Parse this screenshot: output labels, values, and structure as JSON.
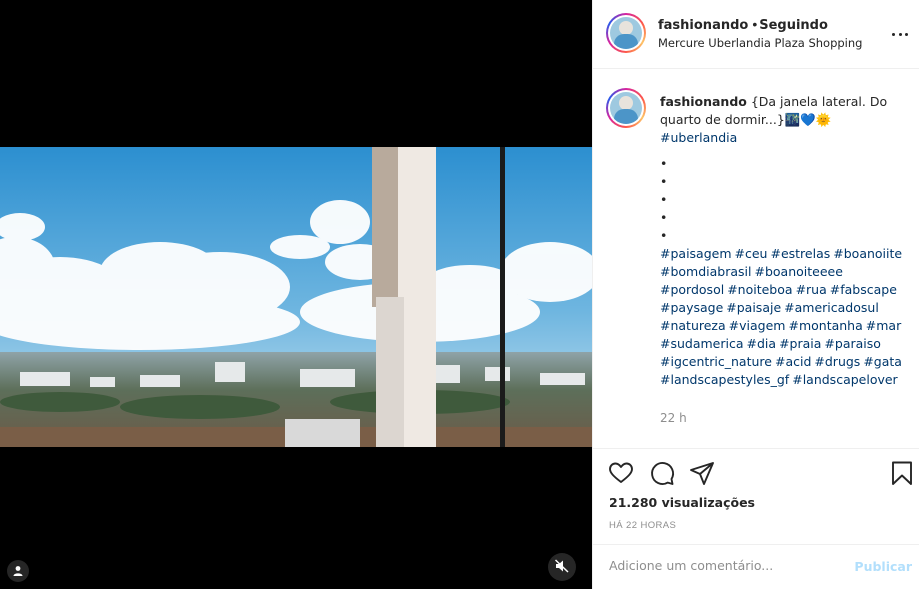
{
  "post": {
    "username": "fashionando",
    "separator": "•",
    "follow_status": "Seguindo",
    "location": "Mercure Uberlandia Plaza Shopping",
    "more_icon": "more-options-icon"
  },
  "caption": {
    "username": "fashionando",
    "text": "{Da janela lateral. Do quarto de dormir...}🌃💙🌞",
    "first_hashtag": "#uberlandia",
    "dots": [
      "•",
      "•",
      "•",
      "•",
      "•"
    ],
    "hashtags": [
      "#paisagem",
      "#ceu",
      "#estrelas",
      "#boanoiite",
      "#bomdiabrasil",
      "#boanoiteeee",
      "#pordosol",
      "#noiteboa",
      "#rua",
      "#fabscape",
      "#paysage",
      "#paisaje",
      "#americadosul",
      "#natureza",
      "#viagem",
      "#montanha",
      "#mar",
      "#sudamerica",
      "#dia",
      "#praia",
      "#paraiso",
      "#igcentric_nature",
      "#acid",
      "#drugs",
      "#gata",
      "#landscapestyles_gf",
      "#landscapelover"
    ],
    "time": "22 h"
  },
  "actions": {
    "like_icon": "heart-icon",
    "comment_icon": "comment-icon",
    "share_icon": "share-icon",
    "save_icon": "bookmark-icon",
    "views": "21.280 visualizações",
    "posted": "HÁ 22 HORAS"
  },
  "comment_box": {
    "placeholder": "Adicione um comentário...",
    "publish_label": "Publicar"
  },
  "media": {
    "tag_icon": "user-tag-icon",
    "mute_icon": "muted-speaker-icon"
  },
  "colors": {
    "hashtag": "#00376b",
    "muted_text": "#8e8e8e",
    "publish_disabled": "#b2dffc",
    "border": "#efefef"
  }
}
